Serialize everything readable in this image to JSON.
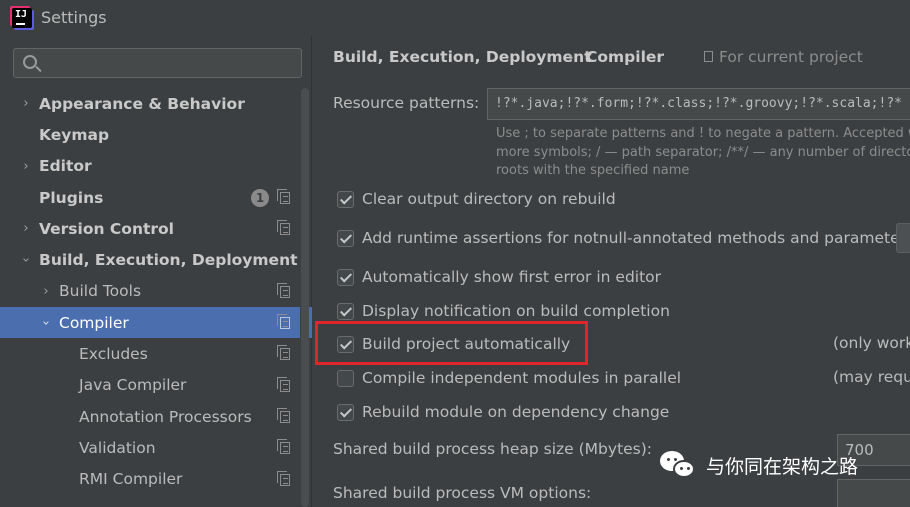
{
  "window": {
    "title": "Settings"
  },
  "search": {
    "placeholder": ""
  },
  "sidebar": {
    "items": [
      {
        "label": "Appearance & Behavior",
        "expanded": false,
        "level": 0
      },
      {
        "label": "Keymap",
        "level": 0
      },
      {
        "label": "Editor",
        "expanded": false,
        "level": 0
      },
      {
        "label": "Plugins",
        "level": 0,
        "badge": "1"
      },
      {
        "label": "Version Control",
        "expanded": false,
        "level": 0
      },
      {
        "label": "Build, Execution, Deployment",
        "expanded": true,
        "level": 0
      },
      {
        "label": "Build Tools",
        "expanded": false,
        "level": 1
      },
      {
        "label": "Compiler",
        "expanded": true,
        "level": 1,
        "selected": true
      },
      {
        "label": "Excludes",
        "level": 2
      },
      {
        "label": "Java Compiler",
        "level": 2
      },
      {
        "label": "Annotation Processors",
        "level": 2
      },
      {
        "label": "Validation",
        "level": 2
      },
      {
        "label": "RMI Compiler",
        "level": 2
      }
    ]
  },
  "main": {
    "breadcrumb": {
      "parent": "Build, Execution, Deployment",
      "separator": "›",
      "current": "Compiler"
    },
    "scope_label": "For current project",
    "resource_patterns": {
      "label": "Resource patterns:",
      "value": "!?*.java;!?*.form;!?*.class;!?*.groovy;!?*.scala;!?*",
      "hint_lines": [
        "Use ; to separate patterns and ! to negate a pattern. Accepted wilde",
        "more symbols; / — path separator; /**/ — any number of directorie",
        "roots with the specified name"
      ]
    },
    "options": [
      {
        "label": "Clear output directory on rebuild",
        "checked": true
      },
      {
        "label": "Add runtime assertions for notnull-annotated methods and parameters",
        "checked": true
      },
      {
        "label": "Automatically show first error in editor",
        "checked": true
      },
      {
        "label": "Display notification on build completion",
        "checked": true
      },
      {
        "label": "Build project automatically",
        "checked": true,
        "note": "(only work"
      },
      {
        "label": "Compile independent modules in parallel",
        "checked": false,
        "note": "(may requi"
      },
      {
        "label": "Rebuild module on dependency change",
        "checked": true
      }
    ],
    "heap_size": {
      "label": "Shared build process heap size (Mbytes):",
      "value": "700"
    },
    "vm_options": {
      "label": "Shared build process VM options:",
      "value": ""
    }
  },
  "watermark": {
    "text": "与你同在架构之路"
  },
  "colors": {
    "background": "#3c3f41",
    "selection": "#4b6eaf",
    "highlight_box": "#e0262b"
  }
}
